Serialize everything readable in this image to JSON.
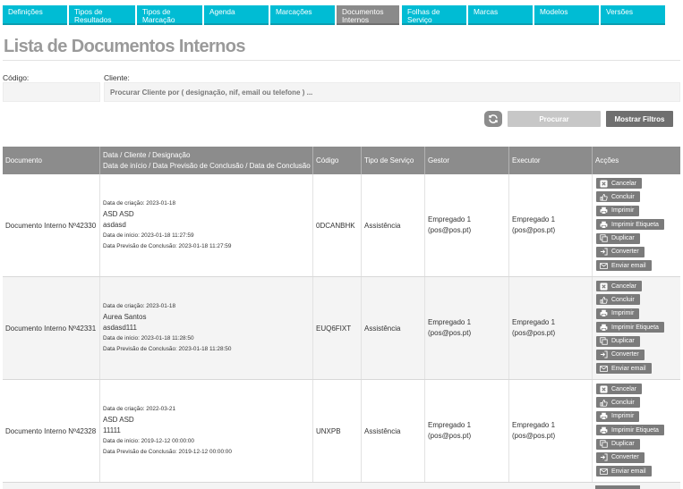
{
  "nav": {
    "tabs": [
      {
        "label": "Definições"
      },
      {
        "label": "Tipos de Resultados"
      },
      {
        "label": "Tipos de Marcação"
      },
      {
        "label": "Agenda"
      },
      {
        "label": "Marcações"
      },
      {
        "label": "Documentos Internos"
      },
      {
        "label": "Folhas de Serviço"
      },
      {
        "label": "Marcas"
      },
      {
        "label": "Modelos"
      },
      {
        "label": "Versões"
      }
    ],
    "active_index": 5,
    "accent_color": "#00bcd4"
  },
  "page": {
    "title": "Lista de Documentos Internos"
  },
  "filters": {
    "code_label": "Código:",
    "code_value": "",
    "client_label": "Cliente:",
    "client_placeholder": "Procurar Cliente por ( designação, nif, email ou telefone ) ...",
    "search_label": "Procurar",
    "show_filters_label": "Mostrar Filtros",
    "refresh_icon": "refresh-icon"
  },
  "table": {
    "headers": {
      "documento": "Documento",
      "data_line1": "Data / Cliente / Designação",
      "data_line2": "Data de início / Data Previsão de Conclusão / Data de Conclusão",
      "codigo": "Código",
      "tipo": "Tipo de Serviço",
      "gestor": "Gestor",
      "executor": "Executor",
      "accoes": "Acções"
    },
    "actions": [
      {
        "label": "Cancelar",
        "icon": "x-icon"
      },
      {
        "label": "Concluir",
        "icon": "thumbs-up-icon"
      },
      {
        "label": "Imprimir",
        "icon": "printer-icon"
      },
      {
        "label": "Imprimir Etiqueta",
        "icon": "printer-icon"
      },
      {
        "label": "Duplicar",
        "icon": "copy-icon"
      },
      {
        "label": "Converter",
        "icon": "sign-in-icon"
      },
      {
        "label": "Enviar email",
        "icon": "envelope-icon"
      }
    ],
    "rows": [
      {
        "documento": "Documento Interno Nº42330",
        "data_criacao": "Data de criação: 2023-01-18",
        "cliente": "ASD ASD",
        "designacao": "asdasd",
        "data_inicio": "Data de início: 2023-01-18 11:27:59",
        "data_previsao": "Data Previsão de Conclusão: 2023-01-18 11:27:59",
        "codigo": "0DCANBHK",
        "tipo": "Assistência",
        "gestor_name": "Empregado 1",
        "gestor_email": "(pos@pos.pt)",
        "executor_name": "Empregado 1",
        "executor_email": "(pos@pos.pt)"
      },
      {
        "documento": "Documento Interno Nº42331",
        "data_criacao": "Data de criação: 2023-01-18",
        "cliente": "Aurea Santos",
        "designacao": "asdasd111",
        "data_inicio": "Data de início: 2023-01-18 11:28:50",
        "data_previsao": "Data Previsão de Conclusão: 2023-01-18 11:28:50",
        "codigo": "EUQ6FIXT",
        "tipo": "Assistência",
        "gestor_name": "Empregado 1",
        "gestor_email": "(pos@pos.pt)",
        "executor_name": "Empregado 1",
        "executor_email": "(pos@pos.pt)"
      },
      {
        "documento": "Documento Interno Nº42328",
        "data_criacao": "Data de criação: 2022-03-21",
        "cliente": "ASD ASD",
        "designacao": "11111",
        "data_inicio": "Data de início: 2019-12-12 00:00:00",
        "data_previsao": "Data Previsão de Conclusão: 2019-12-12 00:00:00",
        "codigo": "UNXPB",
        "tipo": "Assistência",
        "gestor_name": "Empregado 1",
        "gestor_email": "(pos@pos.pt)",
        "executor_name": "Empregado 1",
        "executor_email": "(pos@pos.pt)"
      }
    ]
  }
}
